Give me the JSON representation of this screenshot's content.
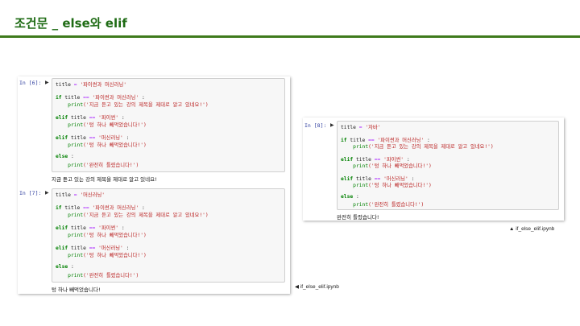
{
  "slide": {
    "title": "조건문 _ else와 elif",
    "accent_color": "#1e6b14",
    "rule_color": "#3f7a1c"
  },
  "left_shot": {
    "caption": "◀ if_else_elif.ipynb",
    "cells": [
      {
        "prompt": "In [6]:",
        "assign_var": "title",
        "assign_op": " = ",
        "assign_val": "'파이썬과 머신러닝'",
        "lines": [
          {
            "kw": "if ",
            "var": "title ",
            "op": "== ",
            "str": "'파이썬과 머신러닝'",
            "tail": " :"
          },
          {
            "indent": "    ",
            "fn": "print",
            "str": "('지금 듣고 있는 강의 제목을 제대로 알고 있네요!')"
          },
          {
            "kw": "elif ",
            "var": "title ",
            "op": "== ",
            "str": "'파이썬'",
            "tail": " :"
          },
          {
            "indent": "    ",
            "fn": "print",
            "str": "('텅 하나 빼먹었습니다!')"
          },
          {
            "kw": "elif ",
            "var": "title ",
            "op": "== ",
            "str": "'머신러닝'",
            "tail": " :"
          },
          {
            "indent": "    ",
            "fn": "print",
            "str": "('텅 하나 빼먹었습니다!')"
          },
          {
            "kw": "else",
            "tail": " :"
          },
          {
            "indent": "    ",
            "fn": "print",
            "str": "('완전히 틀렸습니다!')"
          }
        ],
        "output": "지금 듣고 있는 강의 제목을 제대로 알고 있네요!"
      },
      {
        "prompt": "In [7]:",
        "assign_var": "title",
        "assign_op": " = ",
        "assign_val": "'머신러닝'",
        "lines": [
          {
            "kw": "if ",
            "var": "title ",
            "op": "== ",
            "str": "'파이썬과 머신러닝'",
            "tail": " :"
          },
          {
            "indent": "    ",
            "fn": "print",
            "str": "('지금 듣고 있는 강의 제목을 제대로 알고 있네요!')"
          },
          {
            "kw": "elif ",
            "var": "title ",
            "op": "== ",
            "str": "'파이썬'",
            "tail": " :"
          },
          {
            "indent": "    ",
            "fn": "print",
            "str": "('텅 하나 빼먹었습니다!')"
          },
          {
            "kw": "elif ",
            "var": "title ",
            "op": "== ",
            "str": "'머신러닝'",
            "tail": " :"
          },
          {
            "indent": "    ",
            "fn": "print",
            "str": "('텅 하나 빼먹었습니다!')"
          },
          {
            "kw": "else",
            "tail": " :"
          },
          {
            "indent": "    ",
            "fn": "print",
            "str": "('완전히 틀렸습니다!')"
          }
        ],
        "output": "텅 하나 빼먹었습니다!"
      }
    ]
  },
  "right_shot": {
    "caption": "▲ if_else_elif.ipynb",
    "cells": [
      {
        "prompt": "In [8]:",
        "assign_var": "title",
        "assign_op": " = ",
        "assign_val": "'자바'",
        "lines": [
          {
            "kw": "if ",
            "var": "title ",
            "op": "== ",
            "str": "'파이썬과 머신러닝'",
            "tail": " :"
          },
          {
            "indent": "    ",
            "fn": "print",
            "str": "('지금 듣고 있는 강의 제목을 제대로 알고 있네요!')"
          },
          {
            "kw": "elif ",
            "var": "title ",
            "op": "== ",
            "str": "'파이썬'",
            "tail": " :"
          },
          {
            "indent": "    ",
            "fn": "print",
            "str": "('텅 하나 빼먹었습니다!')"
          },
          {
            "kw": "elif ",
            "var": "title ",
            "op": "== ",
            "str": "'머신러닝'",
            "tail": " :"
          },
          {
            "indent": "    ",
            "fn": "print",
            "str": "('텅 하나 빼먹었습니다!')"
          },
          {
            "kw": "else",
            "tail": " :"
          },
          {
            "indent": "    ",
            "fn": "print",
            "str": "('완전히 틀렸습니다!')"
          }
        ],
        "output": "완전히 틀렸습니다!"
      }
    ]
  }
}
